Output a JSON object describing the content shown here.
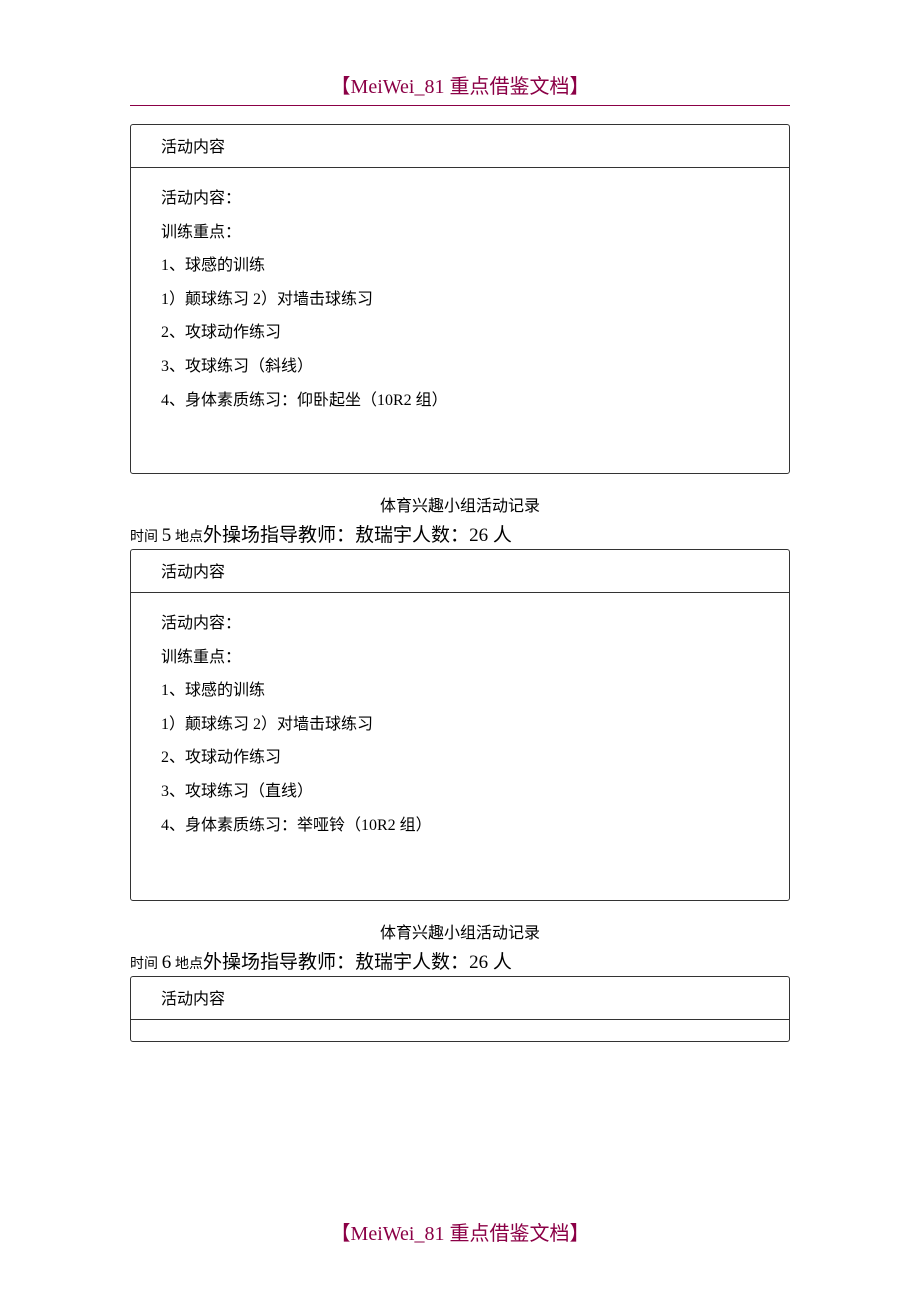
{
  "header": "【MeiWei_81 重点借鉴文档】",
  "footer": "【MeiWei_81 重点借鉴文档】",
  "blocks": [
    {
      "box_header": "活动内容",
      "lines": [
        "活动内容：",
        "训练重点：",
        "1、球感的训练",
        "1）颠球练习 2）对墙击球练习",
        "2、攻球动作练习",
        "3、攻球练习（斜线）",
        "4、身体素质练习：仰卧起坐（10R2 组）"
      ]
    },
    {
      "title": "体育兴趣小组活动记录",
      "meta_time_label": "时间",
      "meta_time_value": "5",
      "meta_place_label": "地点",
      "meta_place_value": "外操场",
      "meta_teacher_label": "指导教师：",
      "meta_teacher_value": "敖瑞宇",
      "meta_count_label": "人数：",
      "meta_count_value": "26 人",
      "box_header": "活动内容",
      "lines": [
        "活动内容：",
        "训练重点：",
        "1、球感的训练",
        "1）颠球练习 2）对墙击球练习",
        "2、攻球动作练习",
        "3、攻球练习（直线）",
        "4、身体素质练习：举哑铃（10R2 组）"
      ]
    },
    {
      "title": "体育兴趣小组活动记录",
      "meta_time_label": "时间",
      "meta_time_value": "6",
      "meta_place_label": "地点",
      "meta_place_value": "外操场",
      "meta_teacher_label": "指导教师：",
      "meta_teacher_value": "敖瑞宇",
      "meta_count_label": "人数：",
      "meta_count_value": "26 人",
      "box_header": "活动内容"
    }
  ]
}
